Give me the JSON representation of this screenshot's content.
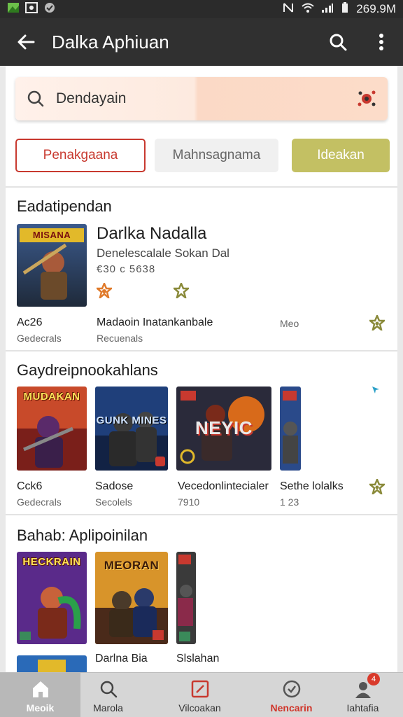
{
  "status_bar": {
    "battery_text": "269.9M"
  },
  "app_bar": {
    "title": "Dalka Aphiuan"
  },
  "search": {
    "value": "Dendayain"
  },
  "chips": [
    "Penakgaana",
    "Mahnsagnama",
    "Ideakan"
  ],
  "featured": {
    "section_title": "Eadatipendan",
    "cover_title": "MISANA",
    "title": "Darlka Nadalla",
    "subtitle": "Denelescalale Sokan Dal",
    "meta": "€30 c 5638",
    "row": [
      {
        "name": "Ac26",
        "sub": "Gedecrals"
      },
      {
        "name": "Madaoin Inatankanbale",
        "sub": "Recuenals"
      },
      {
        "name": "Meo",
        "sub": ""
      }
    ]
  },
  "section2": {
    "title": "Gaydreipnookahlans",
    "tiles": [
      {
        "art": "MUDAKAN",
        "label": "Cck6",
        "sub": "Gedecrals"
      },
      {
        "art": "GUNK MINES",
        "label": "Sadose",
        "sub": "Secolels"
      },
      {
        "art": "NEYIC",
        "label": "Vecedonlintecialer",
        "sub": "7910"
      },
      {
        "art": "",
        "label": "Sethe lolalks",
        "sub": "1 23"
      }
    ]
  },
  "section3": {
    "title": "Bahab: Aplipoinilan",
    "tiles": [
      {
        "art": "HECKRAIN",
        "label": ""
      },
      {
        "art": "MEORAN",
        "label": "Darlna Bia"
      },
      {
        "art": "",
        "label": "Slslahan"
      }
    ]
  },
  "bottom_nav": [
    {
      "label": "Meoik",
      "icon": "home-icon"
    },
    {
      "label": "Marola",
      "icon": "search-icon"
    },
    {
      "label": "Vilcoakan",
      "icon": "edit-icon"
    },
    {
      "label": "Nencarin",
      "icon": "clock-icon"
    },
    {
      "label": "Iahtafia",
      "icon": "profile-icon",
      "badge": "4"
    }
  ],
  "colors": {
    "accent_red": "#c8392f",
    "chip_olive": "#c3c063",
    "appbar": "#303030"
  }
}
